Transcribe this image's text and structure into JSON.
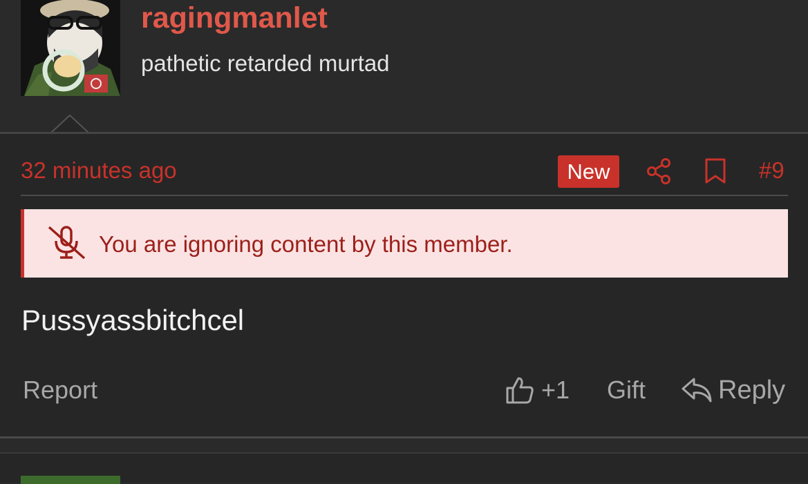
{
  "post": {
    "username": "ragingmanlet",
    "user_title": "pathetic retarded murtad",
    "timestamp": "32 minutes ago",
    "badge": "New",
    "post_number": "#9",
    "ignore_notice": "You are ignoring content by this member.",
    "content": "Pussyassbitchcel",
    "actions": {
      "report": "Report",
      "like_count": "+1",
      "gift": "Gift",
      "reply": "Reply"
    }
  },
  "icons": {
    "share": "share-icon",
    "bookmark": "bookmark-icon",
    "ignore": "muted-microphone-icon",
    "like": "thumbs-up-icon",
    "reply": "reply-arrow-icon"
  },
  "colors": {
    "accent": "#c8322a",
    "username": "#e0584a",
    "notice_bg": "#fbe3e3",
    "page_bg": "#2a2a2a"
  }
}
